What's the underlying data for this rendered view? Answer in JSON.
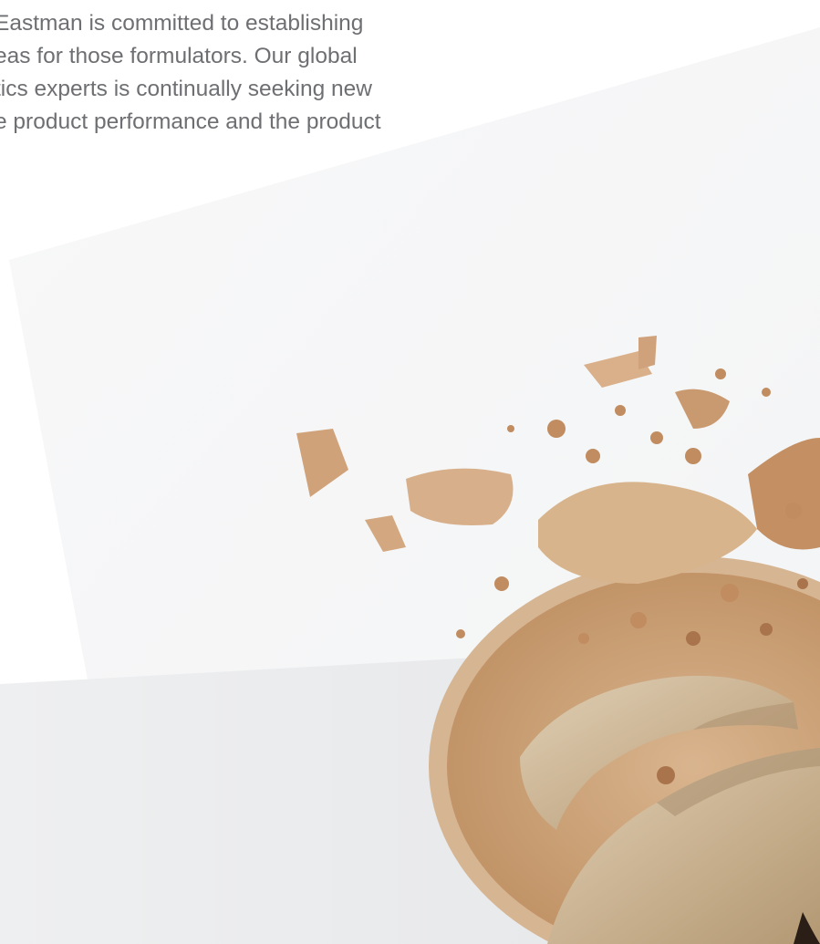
{
  "body_text_lines": [
    "Eastman is committed to establishing",
    "eas for those formulators. Our global",
    "tics experts is continually seeking new",
    "e product performance and the product"
  ],
  "colors": {
    "text": "#6e6f72",
    "panel_light": "#f7f7f8",
    "panel_gray": "#e9eaec",
    "powder_light": "#e3c8a8",
    "powder_mid": "#c99f78",
    "powder_dark": "#a9744c",
    "cake_beige": "#cbb596"
  }
}
